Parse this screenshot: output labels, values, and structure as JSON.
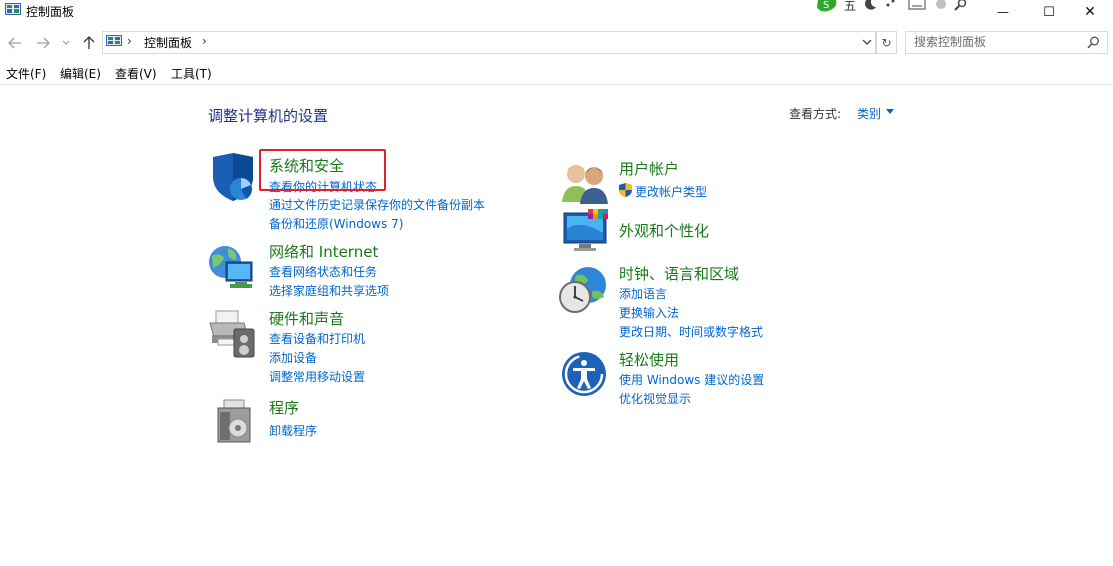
{
  "window": {
    "title": "控制面板",
    "minimize_glyph": "—",
    "maximize_glyph": "☐",
    "close_glyph": "✕"
  },
  "ime": {
    "mode": "五"
  },
  "address": {
    "root_sep": "›",
    "crumb": "控制面板",
    "crumb_sep": "›",
    "dropdown_glyph": "⌄",
    "refresh_glyph": "↻",
    "search_placeholder": "搜索控制面板"
  },
  "menu": {
    "file": "文件(F)",
    "edit": "编辑(E)",
    "view": "查看(V)",
    "tools": "工具(T)"
  },
  "content": {
    "title": "调整计算机的设置",
    "view_by_label": "查看方式:",
    "view_by_value": "类别"
  },
  "categories": {
    "system": {
      "title": "系统和安全",
      "links": [
        "查看你的计算机状态",
        "通过文件历史记录保存你的文件备份副本",
        "备份和还原(Windows 7)"
      ]
    },
    "network": {
      "title": "网络和 Internet",
      "links": [
        "查看网络状态和任务",
        "选择家庭组和共享选项"
      ]
    },
    "hardware": {
      "title": "硬件和声音",
      "links": [
        "查看设备和打印机",
        "添加设备",
        "调整常用移动设置"
      ]
    },
    "programs": {
      "title": "程序",
      "links": [
        "卸载程序"
      ]
    },
    "users": {
      "title": "用户帐户",
      "links": [
        "更改帐户类型"
      ]
    },
    "appearance": {
      "title": "外观和个性化",
      "links": []
    },
    "clock": {
      "title": "时钟、语言和区域",
      "links": [
        "添加语言",
        "更换输入法",
        "更改日期、时间或数字格式"
      ]
    },
    "ease": {
      "title": "轻松使用",
      "links": [
        "使用 Windows 建议的设置",
        "优化视觉显示"
      ]
    }
  },
  "colors": {
    "category_title": "#1a7a1a",
    "link": "#0066cc",
    "heading": "#1e3287",
    "highlight_border": "#e0202a"
  }
}
